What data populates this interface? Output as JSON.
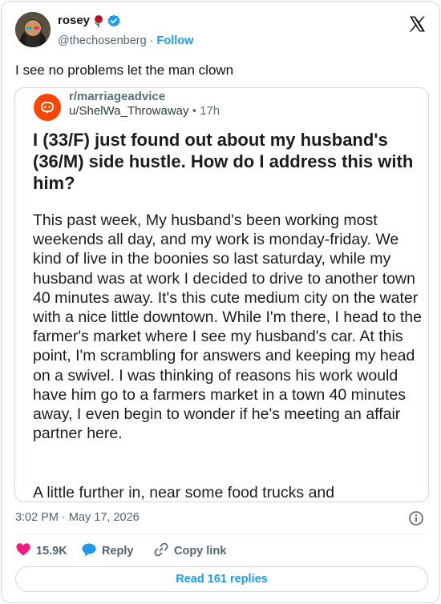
{
  "author": {
    "name": "rosey",
    "handle": "@thechosenberg",
    "separator": "·",
    "follow_label": "Follow"
  },
  "tweet": {
    "text": "I see no problems let the man clown",
    "timestamp": "3:02 PM · May 17, 2026"
  },
  "embedded_post": {
    "subreddit": "r/marriageadvice",
    "username": "u/ShelWa_Throwaway",
    "dot": "•",
    "age": "17h",
    "title": "I (33/F) just found out about my husband's (36/M) side hustle. How do I address this with him?",
    "body": "This past week, My husband's been working most weekends all day, and my work is monday-friday. We kind of live in the boonies so last saturday, while my husband was at work I decided to drive to another town 40 minutes away. It's this cute medium city on the water with a nice little downtown. While I'm there, I head to the farmer's market where I see my husband's car. At this point, I'm scrambling for answers and keeping my head on a swivel. I was thinking of reasons his work would have him go to a farmers market in a town 40 minutes away, I even begin to wonder if he's meeting an affair partner here.",
    "body_continued": "A little further in, near some food trucks and"
  },
  "actions": {
    "like_count": "15.9K",
    "reply_label": "Reply",
    "copy_label": "Copy link"
  },
  "replies_button_label": "Read 161 replies",
  "colors": {
    "accent": "#1d9bf0",
    "like": "#f91880",
    "reddit": "#ff4500",
    "muted": "#536471"
  },
  "icons": [
    "x-logo-icon",
    "verified-badge-icon",
    "rose-icon",
    "reddit-logo-icon",
    "info-icon",
    "heart-icon",
    "reply-bubble-icon",
    "link-icon"
  ]
}
